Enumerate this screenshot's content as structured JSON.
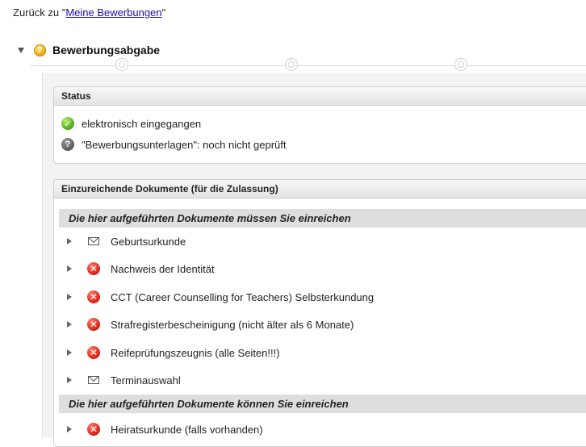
{
  "back": {
    "prefix": "Zurück zu ",
    "quote_open": "\"",
    "link": "Meine Bewerbungen",
    "quote_close": "\""
  },
  "section": {
    "title": "Bewerbungsabgabe"
  },
  "status": {
    "header": "Status",
    "items": [
      {
        "icon": "checkmark-green-icon",
        "text": "elektronisch eingegangen"
      },
      {
        "icon": "question-gray-icon",
        "text": "\"Bewerbungsunterlagen\": noch nicht geprüft"
      }
    ]
  },
  "documents": {
    "header": "Einzureichende Dokumente (für die Zulassung)",
    "required_heading": "Die hier aufgeführten Dokumente müssen Sie einreichen",
    "required": [
      {
        "icon": "mail-icon",
        "label": "Geburtsurkunde"
      },
      {
        "icon": "red-x-icon",
        "label": "Nachweis der Identität"
      },
      {
        "icon": "red-x-icon",
        "label": "CCT (Career Counselling for Teachers) Selbsterkundung"
      },
      {
        "icon": "red-x-icon",
        "label": "Strafregisterbescheinigung (nicht älter als 6 Monate)"
      },
      {
        "icon": "red-x-icon",
        "label": "Reifeprüfungszeugnis (alle Seiten!!!)"
      },
      {
        "icon": "mail-icon",
        "label": "Terminauswahl"
      }
    ],
    "optional_heading": "Die hier aufgeführten Dokumente können Sie einreichen",
    "optional": [
      {
        "icon": "red-x-icon",
        "label": "Heiratsurkunde (falls vorhanden)"
      }
    ]
  },
  "icons": {
    "x_glyph": "✕",
    "check_glyph": "✓",
    "question_glyph": "?"
  }
}
